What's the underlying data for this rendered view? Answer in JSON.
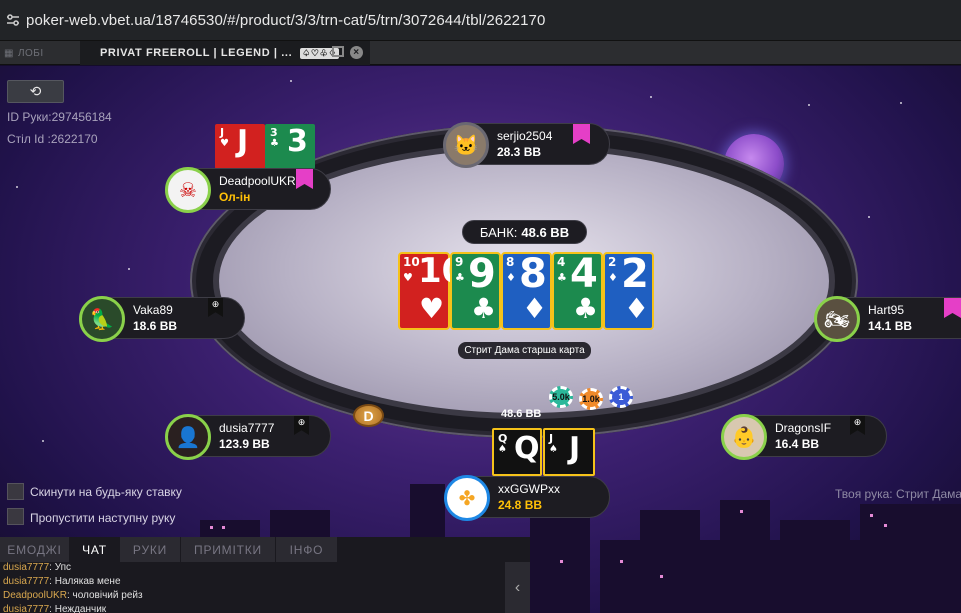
{
  "browser": {
    "url": "poker-web.vbet.ua/18746530/#/product/3/3/trn-cat/5/trn/3072644/tbl/2622170"
  },
  "tabs": {
    "lobby_label": "ЛОБІ",
    "table_label": "PRIVAT FREEROLL | LEGEND | ...",
    "table_suits": "♤♡♧♢"
  },
  "hand_info": {
    "hand_id": "ID Руки:297456184",
    "table_id": "Стіл Id :2622170"
  },
  "pot": {
    "label": "БАНК:",
    "value": "48.6 BB"
  },
  "board_description": "Стрит Дама старша карта",
  "board": [
    {
      "rank": "10",
      "suit": "♥",
      "color": "red"
    },
    {
      "rank": "9",
      "suit": "♣",
      "color": "green"
    },
    {
      "rank": "8",
      "suit": "♦",
      "color": "blue"
    },
    {
      "rank": "4",
      "suit": "♣",
      "color": "green"
    },
    {
      "rank": "2",
      "suit": "♦",
      "color": "blue"
    }
  ],
  "players": {
    "serjio": {
      "name": "serjio2504",
      "stack": "28.3 BB"
    },
    "deadpool": {
      "name": "DeadpoolUKR",
      "stack": "Ол-ін",
      "cards": [
        {
          "rank": "J",
          "suit": "♥"
        },
        {
          "rank": "3",
          "suit": "♣"
        }
      ]
    },
    "vaka": {
      "name": "Vaka89",
      "stack": "18.6 BB"
    },
    "hart": {
      "name": "Hart95",
      "stack": "14.1 BB"
    },
    "dusia": {
      "name": "dusia7777",
      "stack": "123.9 BB"
    },
    "dragons": {
      "name": "DragonsIF",
      "stack": "16.4 BB"
    },
    "hero": {
      "name": "xxGGWPxx",
      "stack": "24.8 BB",
      "cards": [
        {
          "rank": "Q",
          "suit": "♠"
        },
        {
          "rank": "J",
          "suit": "♠"
        }
      ]
    }
  },
  "dealer_button": "D",
  "bet": {
    "amount": "48.6 BB",
    "chips": [
      "5.0k",
      "1.0k",
      "1"
    ]
  },
  "options": {
    "fold_any": "Скинути на будь-яку ставку",
    "skip_hand": "Пропустити наступну руку"
  },
  "your_hand": "Твоя рука: Стрит Дама",
  "panel": {
    "tabs": [
      "ЕМОДЖІ",
      "ЧАТ",
      "РУКИ",
      "ПРИМІТКИ",
      "ІНФО"
    ],
    "messages": [
      {
        "user": "dusia7777",
        "text": "Упс"
      },
      {
        "user": "dusia7777",
        "text": "Налякав мене"
      },
      {
        "user": "DeadpoolUKR",
        "text": "чоловічий рейз"
      },
      {
        "user": "dusia7777",
        "text": "Нежданчик"
      }
    ]
  },
  "colors": {
    "accent": "#8ad14a",
    "bookmark": "#e53fc7",
    "gold": "#ffc107"
  }
}
